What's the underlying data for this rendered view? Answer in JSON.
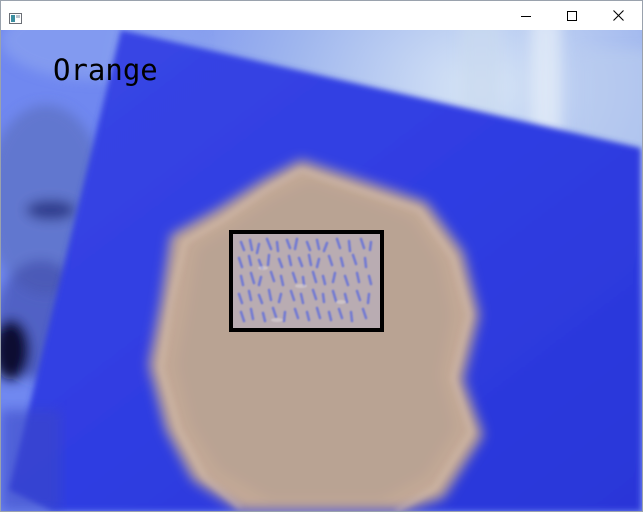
{
  "window": {
    "icon": "window-app-icon",
    "controls": {
      "minimize_icon": "minimize-icon",
      "maximize_icon": "maximize-icon",
      "close_icon": "close-icon"
    }
  },
  "feed": {
    "detected_label": "Orange",
    "colors": {
      "card_blue": "#2f3ee0",
      "background_blue": "#7e95f0",
      "emblem_beige": "#c4aa97",
      "roi_border": "#000000"
    }
  }
}
